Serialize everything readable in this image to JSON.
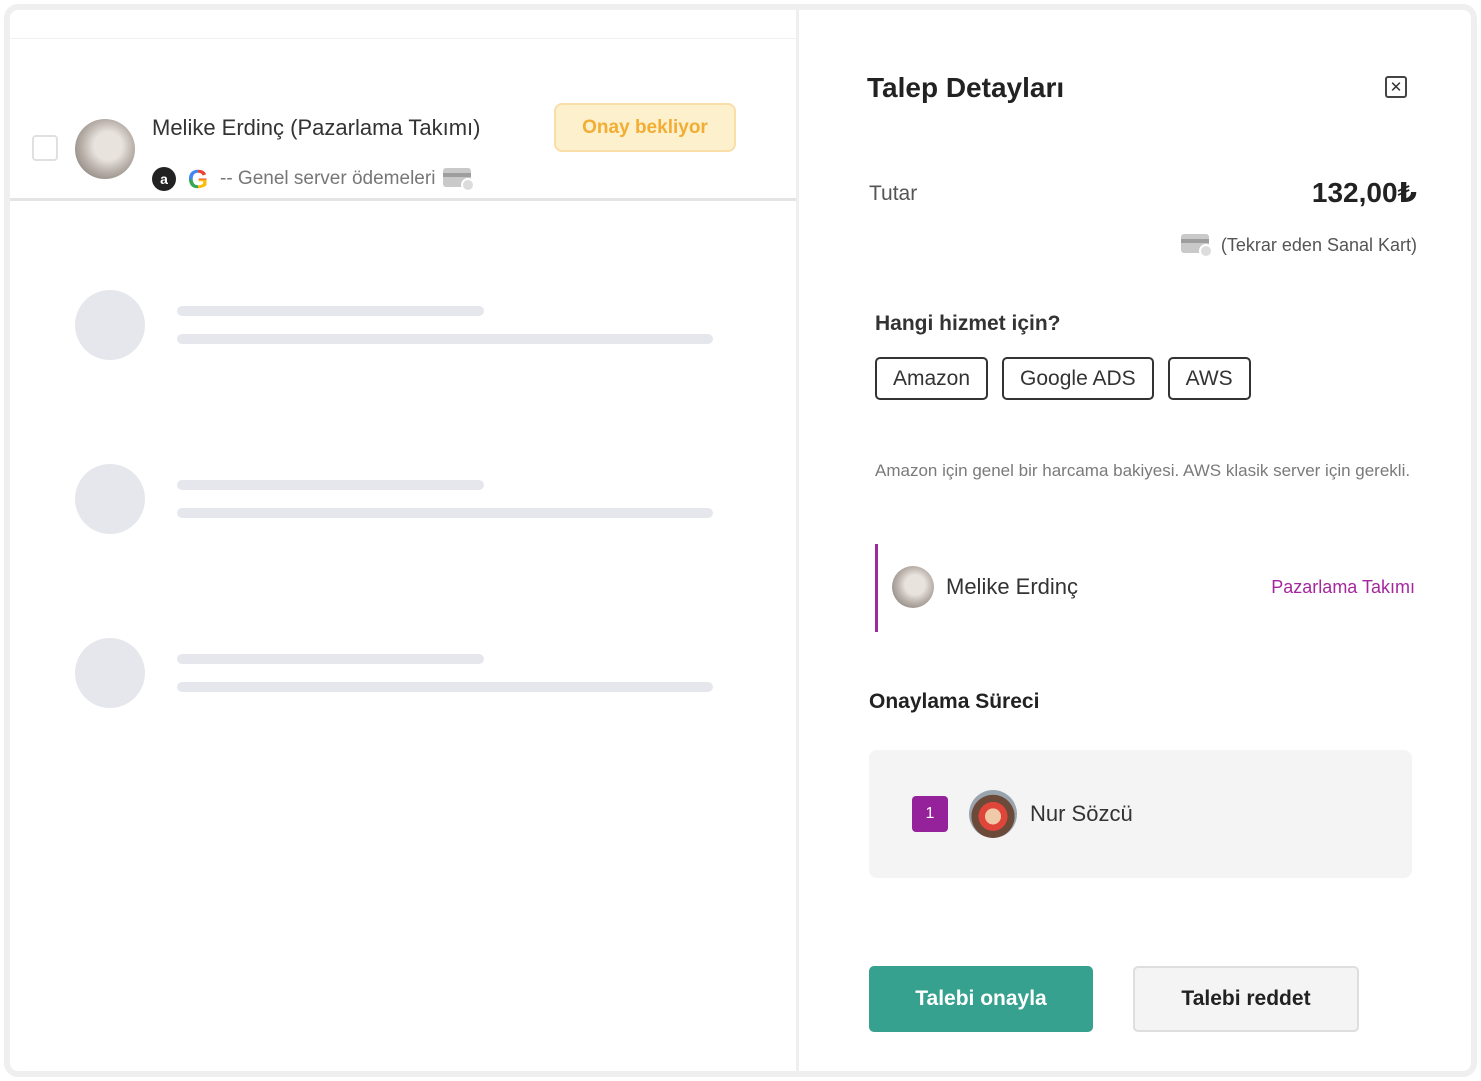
{
  "list": {
    "request": {
      "name": "Melike Erdinç (Pazarlama Takımı)",
      "status": "Onay bekliyor",
      "description": "-- Genel server ödemeleri",
      "service_icons": [
        "amazon-icon",
        "google-icon"
      ],
      "amazon_glyph": "a",
      "google_glyph": "G"
    },
    "skeleton_rows": 3
  },
  "details": {
    "title": "Talep Detayları",
    "close_icon": "close-icon",
    "amount_label": "Tutar",
    "amount": "132,00₺",
    "card_type": "(Tekrar eden Sanal Kart)",
    "service_question": "Hangi hizmet için?",
    "services": [
      "Amazon",
      "Google ADS",
      "AWS"
    ],
    "note": "Amazon için genel bir harcama bakiyesi. AWS klasik server için gerekli.",
    "requester": {
      "name": "Melike Erdinç",
      "team": "Pazarlama Takımı"
    },
    "process_title": "Onaylama Süreci",
    "approvers": [
      {
        "step": "1",
        "name": "Nur Sözcü"
      }
    ],
    "approve_label": "Talebi onayla",
    "reject_label": "Talebi reddet"
  },
  "colors": {
    "accent_purple": "#95229b",
    "approve_green": "#37a18f",
    "pending_orange": "#f2ad35",
    "pending_bg": "#fdf0cc"
  }
}
